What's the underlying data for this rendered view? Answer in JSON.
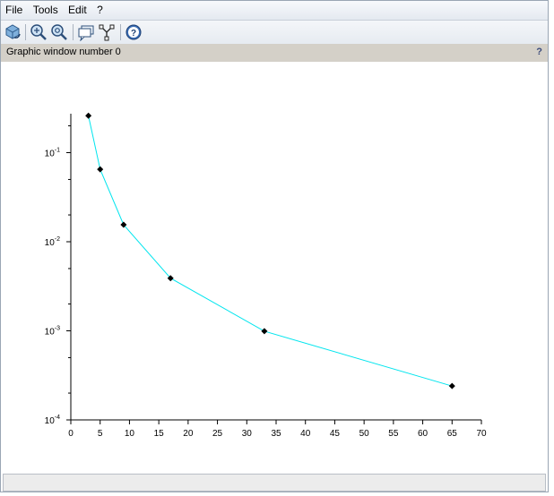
{
  "menubar": {
    "items": [
      "File",
      "Tools",
      "Edit",
      "?"
    ]
  },
  "toolbar": {
    "buttons": [
      "rotate-icon",
      "zoom-in-icon",
      "zoom-out-icon",
      "datatip-icon",
      "editor-icon",
      "help-icon"
    ]
  },
  "window_title": "Graphic window number 0",
  "title_help": "?",
  "colors": {
    "line": "#00e5ee",
    "marker": "#000000",
    "axis": "#000000"
  },
  "chart_data": {
    "type": "line",
    "title": "",
    "xlabel": "",
    "ylabel": "",
    "xlim": [
      0,
      70
    ],
    "ylim": [
      0.0001,
      0.3
    ],
    "yscale": "log",
    "grid": false,
    "x_ticks": [
      "0",
      "5",
      "10",
      "15",
      "20",
      "25",
      "30",
      "35",
      "40",
      "45",
      "50",
      "55",
      "60",
      "65",
      "70"
    ],
    "y_ticks": [
      {
        "base": "10",
        "exp": "-4",
        "value": 0.0001
      },
      {
        "base": "10",
        "exp": "-3",
        "value": 0.001
      },
      {
        "base": "10",
        "exp": "-2",
        "value": 0.01
      },
      {
        "base": "10",
        "exp": "-1",
        "value": 0.1
      }
    ],
    "series": [
      {
        "x": [
          3,
          5,
          9,
          17,
          33,
          65
        ],
        "y": [
          0.26,
          0.065,
          0.0155,
          0.0039,
          0.00099,
          0.00024
        ],
        "marker": "diamond"
      }
    ]
  }
}
